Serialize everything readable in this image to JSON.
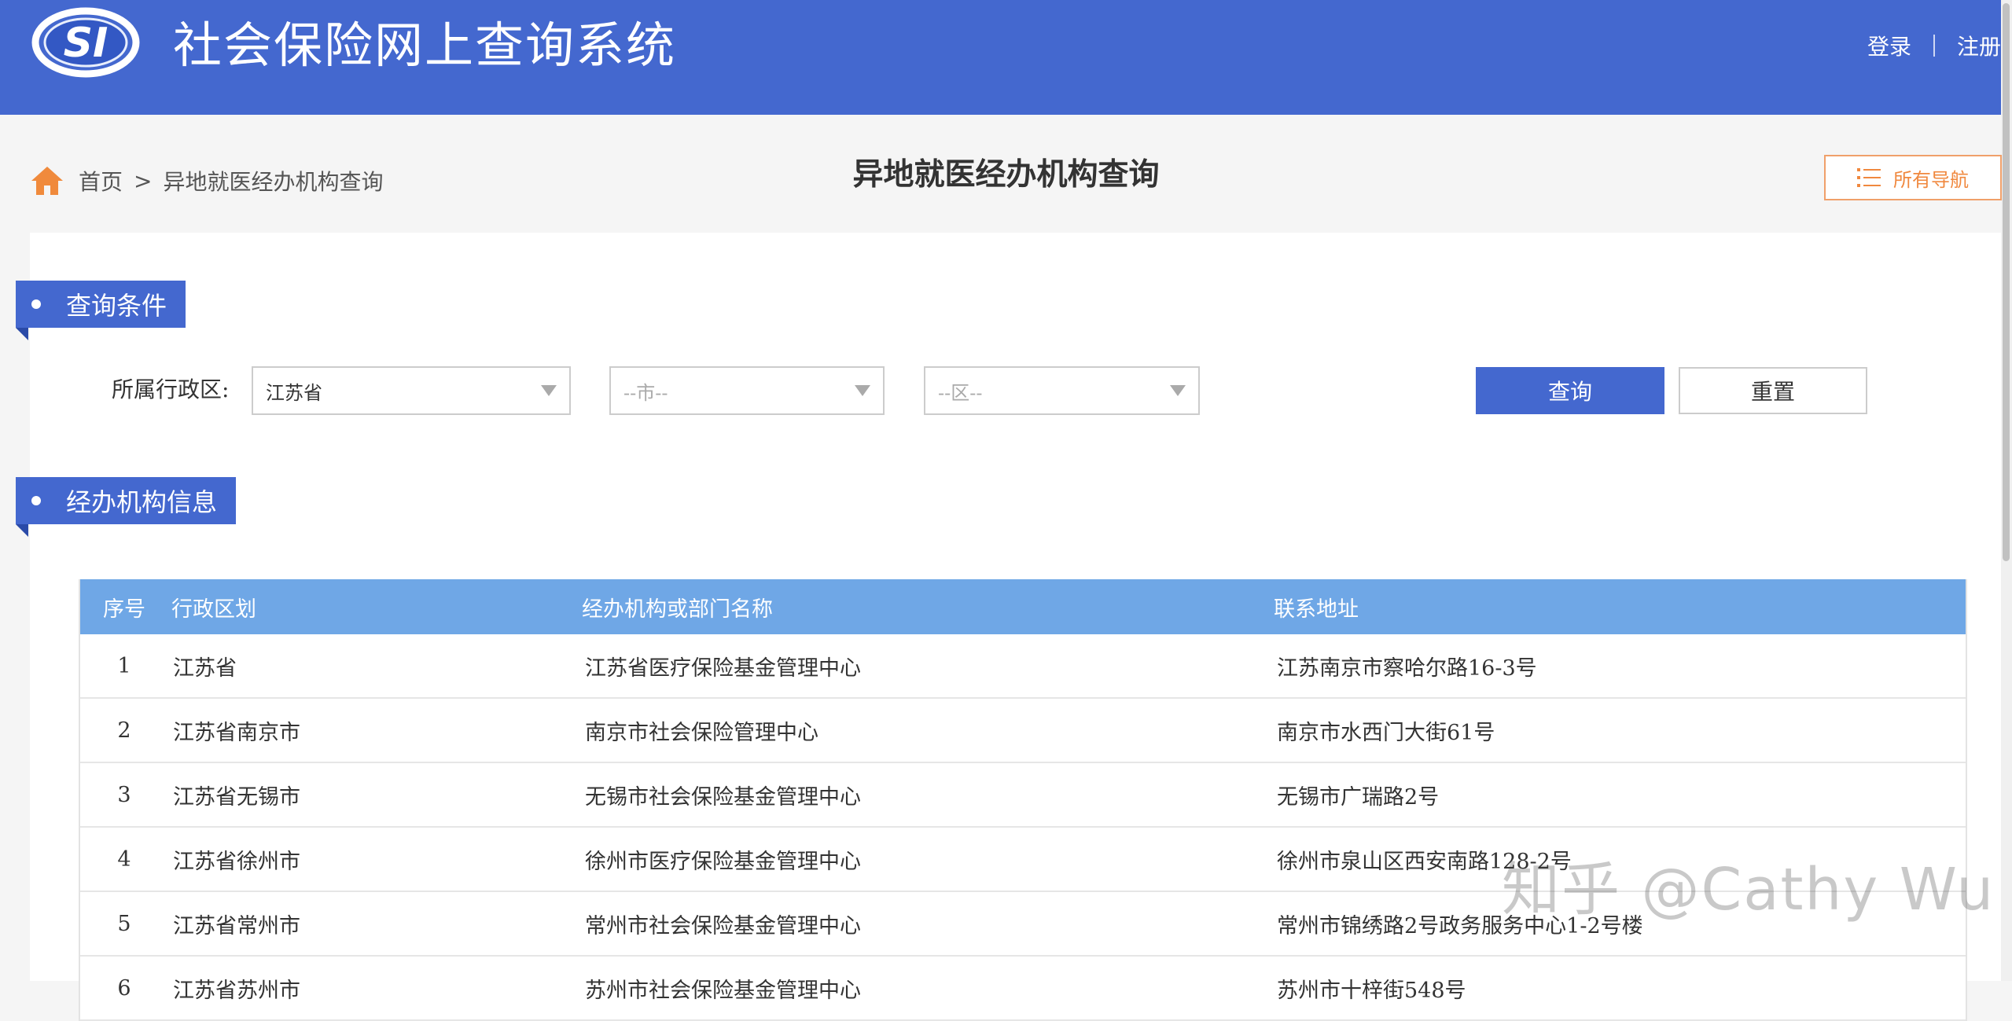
{
  "header": {
    "logo_text": "SI",
    "title": "社会保险网上查询系统",
    "login": "登录",
    "register": "注册"
  },
  "breadcrumb": {
    "home": "首页",
    "separator": ">",
    "current": "异地就医经办机构查询"
  },
  "page_title": "异地就医经办机构查询",
  "all_nav": "所有导航",
  "query_section": {
    "title": "查询条件",
    "region_label": "所属行政区:",
    "province_value": "江苏省",
    "city_placeholder": "--市--",
    "district_placeholder": "--区--",
    "search_button": "查询",
    "reset_button": "重置"
  },
  "info_section": {
    "title": "经办机构信息"
  },
  "table": {
    "headers": [
      "序号",
      "行政区划",
      "经办机构或部门名称",
      "联系地址"
    ],
    "rows": [
      [
        "1",
        "江苏省",
        "江苏省医疗保险基金管理中心",
        "江苏南京市察哈尔路16-3号"
      ],
      [
        "2",
        "江苏省南京市",
        "南京市社会保险管理中心",
        "南京市水西门大街61号"
      ],
      [
        "3",
        "江苏省无锡市",
        "无锡市社会保险基金管理中心",
        "无锡市广瑞路2号"
      ],
      [
        "4",
        "江苏省徐州市",
        "徐州市医疗保险基金管理中心",
        "徐州市泉山区西安南路128-2号"
      ],
      [
        "5",
        "江苏省常州市",
        "常州市社会保险基金管理中心",
        "常州市锦绣路2号政务服务中心1-2号楼"
      ],
      [
        "6",
        "江苏省苏州市",
        "苏州市社会保险基金管理中心",
        "苏州市十梓街548号"
      ]
    ]
  },
  "watermark": "知乎 @Cathy Wu",
  "colors": {
    "header_blue": "#4468cf",
    "table_header_blue": "#6fa7e6",
    "accent_orange": "#f0883e"
  }
}
